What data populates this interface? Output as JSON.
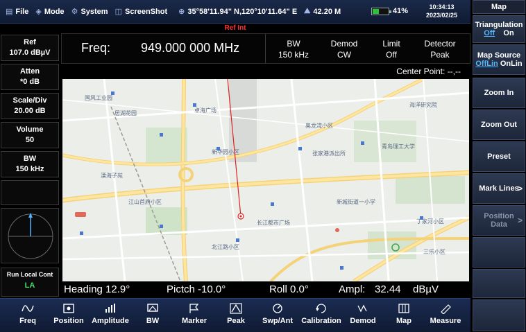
{
  "topbar": {
    "file": "File",
    "mode": "Mode",
    "system": "System",
    "screenshot": "ScreenShot",
    "gps": "35°58'11.94\" N,120°10'11.64\" E",
    "altitude": "42.20 M",
    "battery": "41%",
    "battery_level": 0.41,
    "time": "10:34:13",
    "date": "2023/02/25"
  },
  "ref_int": "Ref Int",
  "left": {
    "ref_label": "Ref",
    "ref_value": "107.0 dBµV",
    "atten_label": "Atten",
    "atten_value": "*0 dB",
    "scale_label": "Scale/Div",
    "scale_value": "20.00 dB",
    "volume_label": "Volume",
    "volume_value": "50",
    "bw_label": "BW",
    "bw_value": "150 kHz",
    "run_local": "Run Local Cont",
    "la": "LA"
  },
  "header": {
    "freq_label": "Freq:",
    "freq_value": "949.000 000 MHz",
    "bw_label": "BW",
    "bw_value": "150 kHz",
    "demod_label": "Demod",
    "demod_value": "CW",
    "limit_label": "Limit",
    "limit_value": "Off",
    "detector_label": "Detector",
    "detector_value": "Peak",
    "center_point": "Center Point: --,--"
  },
  "status": {
    "heading": "Heading 12.9°",
    "pitch": "Pictch -10.0°",
    "roll": "Roll 0.0°",
    "ampl_label": "Ampl:",
    "ampl_value": "32.44",
    "ampl_unit": "dBµV"
  },
  "toolbar": [
    {
      "label": "Freq",
      "icon": "wave-icon"
    },
    {
      "label": "Position",
      "icon": "position-icon"
    },
    {
      "label": "Amplitude",
      "icon": "amplitude-icon"
    },
    {
      "label": "BW",
      "icon": "bw-icon"
    },
    {
      "label": "Marker",
      "icon": "flag-icon"
    },
    {
      "label": "Peak",
      "icon": "peak-icon"
    },
    {
      "label": "Swp/Ant",
      "icon": "sweep-icon"
    },
    {
      "label": "Calibration",
      "icon": "calibration-icon"
    },
    {
      "label": "Demod",
      "icon": "demod-icon"
    },
    {
      "label": "Map",
      "icon": "map-icon"
    },
    {
      "label": "Measure",
      "icon": "ruler-icon"
    }
  ],
  "softkeys": {
    "title": "Map",
    "triangulation": "Triangulation",
    "tri_off": "Off",
    "tri_on": "On",
    "map_source": "Map Source",
    "src_offline": "OffLin",
    "src_online": "OnLin",
    "zoom_in": "Zoom In",
    "zoom_out": "Zoom Out",
    "preset": "Preset",
    "mark_lines": "Mark Lines",
    "position_data_1": "Position",
    "position_data_2": "Data"
  },
  "map_labels": [
    "国风工业园",
    "居湖花园",
    "卓海广场",
    "新华园小区",
    "张家港派出所",
    "溧海子苑",
    "江山首府小区",
    "北江路小区",
    "长江都市广场",
    "新城街道一小学",
    "丁家河小区",
    "三乐小区",
    "奥龙湾小区",
    "青岛理工大学",
    "海洋研究院"
  ],
  "colors": {
    "accent_blue": "#4fb6ff",
    "ref_red": "#ff3030",
    "la_green": "#43e06a",
    "bearing_line": "#e02020"
  }
}
